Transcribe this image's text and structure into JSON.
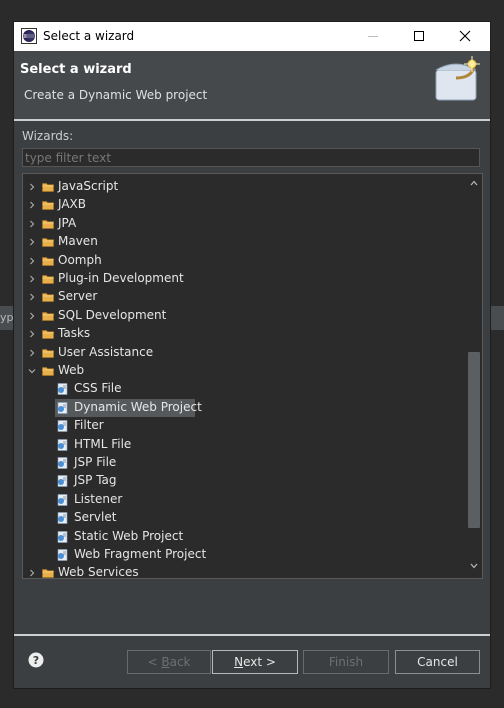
{
  "background": {
    "partial_text": "ype"
  },
  "window": {
    "title": "Select a wizard",
    "controls": [
      "minimize-icon",
      "maximize-icon",
      "close-icon"
    ]
  },
  "header": {
    "title": "Select a wizard",
    "description": "Create a Dynamic Web project"
  },
  "wizards_label": "Wizards:",
  "filter": {
    "placeholder": "type filter text",
    "value": ""
  },
  "tree": {
    "folders_before": [
      "JavaScript",
      "JAXB",
      "JPA",
      "Maven",
      "Oomph",
      "Plug-in Development",
      "Server",
      "SQL Development",
      "Tasks",
      "User Assistance"
    ],
    "expanded": {
      "label": "Web",
      "children": [
        {
          "label": "CSS File",
          "icon": "css-file-icon"
        },
        {
          "label": "Dynamic Web Project",
          "icon": "dynamic-web-project-icon",
          "selected": true
        },
        {
          "label": "Filter",
          "icon": "filter-icon"
        },
        {
          "label": "HTML File",
          "icon": "html-file-icon"
        },
        {
          "label": "JSP File",
          "icon": "jsp-file-icon"
        },
        {
          "label": "JSP Tag",
          "icon": "jsp-tag-icon"
        },
        {
          "label": "Listener",
          "icon": "listener-icon"
        },
        {
          "label": "Servlet",
          "icon": "servlet-icon"
        },
        {
          "label": "Static Web Project",
          "icon": "static-web-project-icon"
        },
        {
          "label": "Web Fragment Project",
          "icon": "web-fragment-project-icon"
        }
      ]
    },
    "folders_after": [
      "Web Services"
    ]
  },
  "buttons": {
    "back": {
      "pre": "< ",
      "u": "B",
      "post": "ack",
      "enabled": false
    },
    "next": {
      "pre": "",
      "u": "N",
      "post": "ext >",
      "enabled": true
    },
    "finish": {
      "label": "Finish",
      "enabled": false
    },
    "cancel": {
      "label": "Cancel",
      "enabled": true
    }
  },
  "colors": {
    "dialog_bg": "#3c3f41",
    "tree_bg": "#2b2b2b",
    "selection": "#55595c",
    "folder": "#e8b04a"
  }
}
